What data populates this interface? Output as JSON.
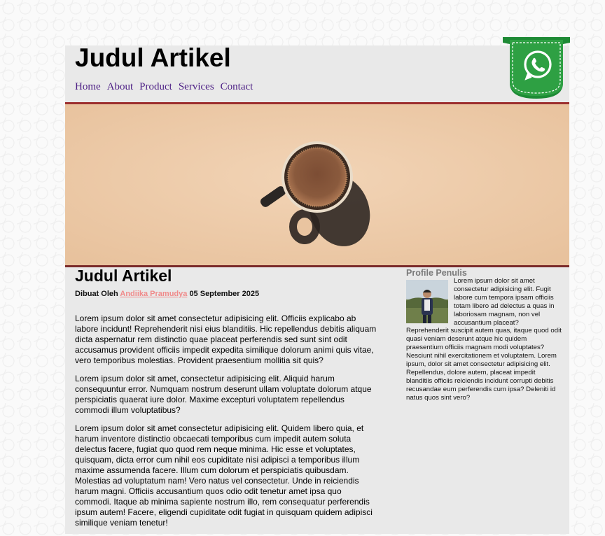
{
  "header": {
    "site_title": "Judul Artikel",
    "nav": [
      "Home",
      "About",
      "Product",
      "Services",
      "Contact"
    ]
  },
  "hero": {
    "image_name": "coffee-cup-photo"
  },
  "article": {
    "title": "Judul Artikel",
    "byline_prefix": "Dibuat Oleh",
    "author": "Andiika Pramudya",
    "date": "05 September 2025",
    "paragraphs": [
      "Lorem ipsum dolor sit amet consectetur adipisicing elit. Officiis explicabo ab labore incidunt! Reprehenderit nisi eius blanditiis. Hic repellendus debitis aliquam dicta aspernatur rem distinctio quae placeat perferendis sed sunt sint odit accusamus provident officiis impedit expedita similique dolorum animi quis vitae, vero temporibus molestias. Provident praesentium mollitia sit quis?",
      "Lorem ipsum dolor sit amet, consectetur adipisicing elit. Aliquid harum consequuntur error. Numquam nostrum deserunt ullam voluptate dolorum atque perspiciatis quaerat iure dolor. Maxime excepturi voluptatem repellendus commodi illum voluptatibus?",
      "Lorem ipsum dolor sit amet consectetur adipisicing elit. Quidem libero quia, et harum inventore distinctio obcaecati temporibus cum impedit autem soluta delectus facere, fugiat quo quod rem neque minima. Hic esse et voluptates, quisquam, dicta error cum nihil eos cupiditate nisi adipisci a temporibus illum maxime assumenda facere. Illum cum dolorum et perspiciatis quibusdam. Molestias ad voluptatum nam! Vero natus vel consectetur. Unde in reiciendis harum magni. Officiis accusantium quos odio odit tenetur amet ipsa quo commodi. Itaque ab minima sapiente nostrum illo, rem consequatur perferendis ipsum autem! Facere, eligendi cupiditate odit fugiat in quisquam quidem adipisci similique veniam tenetur!"
    ]
  },
  "sidebar": {
    "heading": "Profile Penulis",
    "bio": "Lorem ipsum dolor sit amet consectetur adipisicing elit. Fugit labore cum tempora ipsam officiis totam libero ad delectus a quas in laboriosam magnam, non vel accusantium placeat? Reprehenderit suscipit autem quas, itaque quod odit quasi veniam deserunt atque hic quidem praesentium officiis magnam modi voluptates? Nesciunt nihil exercitationem et voluptatem. Lorem ipsum, dolor sit amet consectetur adipisicing elit. Repellendus, dolore autem, placeat impedit blanditiis officiis reiciendis incidunt corrupti debitis recusandae eum perferendis cum ipsa? Deleniti id natus quos sint vero?"
  },
  "colors": {
    "accent_border": "#9c2f2f",
    "nav_link": "#4b1d84",
    "author_link": "#f08a8a",
    "whatsapp_green": "#2ea043"
  }
}
